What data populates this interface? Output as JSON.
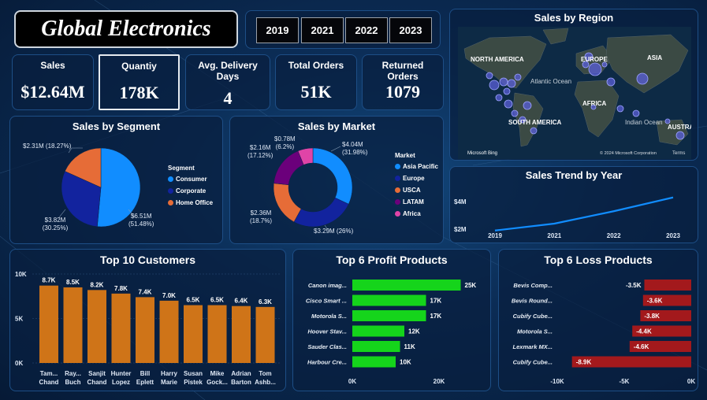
{
  "title": "Global Electronics",
  "years": [
    "2019",
    "2021",
    "2022",
    "2023"
  ],
  "kpis": {
    "sales": {
      "label": "Sales",
      "value": "$12.64M"
    },
    "quantity": {
      "label": "Quantiy",
      "value": "178K"
    },
    "delivery": {
      "label": "Avg. Delivery Days",
      "value": "4"
    },
    "orders": {
      "label": "Total Orders",
      "value": "51K"
    },
    "returned": {
      "label": "Returned Orders",
      "value": "1079"
    }
  },
  "map": {
    "title": "Sales by Region",
    "labels": [
      "NORTH AMERICA",
      "EUROPE",
      "ASIA",
      "Atlantic Ocean",
      "AFRICA",
      "SOUTH AMERICA",
      "Indian Ocean",
      "AUSTRA"
    ],
    "copyright": "© 2024 Microsoft Corporation",
    "terms": "Terms",
    "brand": "Microsoft Bing"
  },
  "segment": {
    "title": "Sales by Segment",
    "legend_title": "Segment",
    "items": [
      {
        "name": "Consumer",
        "label": "$6.51M (51.48%)",
        "pct": 51.48,
        "color": "#118dff"
      },
      {
        "name": "Corporate",
        "label": "$3.82M (30.25%)",
        "pct": 30.25,
        "color": "#12239e"
      },
      {
        "name": "Home Office",
        "label": "$2.31M (18.27%)",
        "pct": 18.27,
        "color": "#e66c37"
      }
    ]
  },
  "market": {
    "title": "Sales by Market",
    "legend_title": "Market",
    "items": [
      {
        "name": "Asia Pacific",
        "label": "$4.04M (31.98%)",
        "pct": 31.98,
        "color": "#118dff"
      },
      {
        "name": "Europe",
        "label": "$3.29M (26%)",
        "pct": 26,
        "color": "#12239e"
      },
      {
        "name": "USCA",
        "label": "$2.36M (18.7%)",
        "pct": 18.7,
        "color": "#e66c37"
      },
      {
        "name": "LATAM",
        "label": "$2.16M (17.12%)",
        "pct": 17.12,
        "color": "#6b007b"
      },
      {
        "name": "Africa",
        "label": "$0.78M (6.2%)",
        "pct": 6.2,
        "color": "#e044a7"
      }
    ]
  },
  "trend": {
    "title": "Sales Trend by Year",
    "y_ticks": [
      "$4M",
      "$2M"
    ],
    "x": [
      "2019",
      "2021",
      "2022",
      "2023"
    ],
    "values": [
      1.9,
      2.4,
      3.3,
      4.3
    ]
  },
  "customers": {
    "title": "Top 10 Customers",
    "y_ticks": [
      "10K",
      "5K",
      "0K"
    ],
    "items": [
      {
        "name": [
          "Tam...",
          "Chand"
        ],
        "value": 8.7,
        "label": "8.7K"
      },
      {
        "name": [
          "Ray...",
          "Buch"
        ],
        "value": 8.5,
        "label": "8.5K"
      },
      {
        "name": [
          "Sanjit",
          "Chand"
        ],
        "value": 8.2,
        "label": "8.2K"
      },
      {
        "name": [
          "Hunter",
          "Lopez"
        ],
        "value": 7.8,
        "label": "7.8K"
      },
      {
        "name": [
          "Bill",
          "Eplett"
        ],
        "value": 7.4,
        "label": "7.4K"
      },
      {
        "name": [
          "Harry",
          "Marie"
        ],
        "value": 7.0,
        "label": "7.0K"
      },
      {
        "name": [
          "Susan",
          "Pistek"
        ],
        "value": 6.5,
        "label": "6.5K"
      },
      {
        "name": [
          "Mike",
          "Gock..."
        ],
        "value": 6.5,
        "label": "6.5K"
      },
      {
        "name": [
          "Adrian",
          "Barton"
        ],
        "value": 6.4,
        "label": "6.4K"
      },
      {
        "name": [
          "Tom",
          "Ashb..."
        ],
        "value": 6.3,
        "label": "6.3K"
      }
    ]
  },
  "profit": {
    "title": "Top 6 Profit Products",
    "x_ticks": [
      "0K",
      "20K"
    ],
    "items": [
      {
        "name": "Canon imag...",
        "value": 25,
        "label": "25K"
      },
      {
        "name": "Cisco Smart ...",
        "value": 17,
        "label": "17K"
      },
      {
        "name": "Motorola S...",
        "value": 17,
        "label": "17K"
      },
      {
        "name": "Hoover Stav...",
        "value": 12,
        "label": "12K"
      },
      {
        "name": "Sauder Clas...",
        "value": 11,
        "label": "11K"
      },
      {
        "name": "Harbour Cre...",
        "value": 10,
        "label": "10K"
      }
    ]
  },
  "loss": {
    "title": "Top 6 Loss Products",
    "x_ticks": [
      "-10K",
      "-5K",
      "0K"
    ],
    "items": [
      {
        "name": "Bevis Comp...",
        "value": -3.5,
        "label": "-3.5K"
      },
      {
        "name": "Bevis Round...",
        "value": -3.6,
        "label": "-3.6K"
      },
      {
        "name": "Cubify Cube...",
        "value": -3.8,
        "label": "-3.8K"
      },
      {
        "name": "Motorola S...",
        "value": -4.4,
        "label": "-4.4K"
      },
      {
        "name": "Lexmark MX...",
        "value": -4.6,
        "label": "-4.6K"
      },
      {
        "name": "Cubify Cube...",
        "value": -8.9,
        "label": "-8.9K"
      }
    ]
  },
  "chart_data": [
    {
      "type": "pie",
      "title": "Sales by Segment",
      "categories": [
        "Consumer",
        "Corporate",
        "Home Office"
      ],
      "values": [
        6.51,
        3.82,
        2.31
      ]
    },
    {
      "type": "pie",
      "title": "Sales by Market",
      "categories": [
        "Asia Pacific",
        "Europe",
        "USCA",
        "LATAM",
        "Africa"
      ],
      "values": [
        4.04,
        3.29,
        2.36,
        2.16,
        0.78
      ]
    },
    {
      "type": "line",
      "title": "Sales Trend by Year",
      "x": [
        "2019",
        "2021",
        "2022",
        "2023"
      ],
      "values": [
        1.9,
        2.4,
        3.3,
        4.3
      ]
    },
    {
      "type": "bar",
      "title": "Top 10 Customers",
      "categories": [
        "Tam... Chand",
        "Ray... Buch",
        "Sanjit Chand",
        "Hunter Lopez",
        "Bill Eplett",
        "Harry Marie",
        "Susan Pistek",
        "Mike Gock...",
        "Adrian Barton",
        "Tom Ashb..."
      ],
      "values": [
        8.7,
        8.5,
        8.2,
        7.8,
        7.4,
        7.0,
        6.5,
        6.5,
        6.4,
        6.3
      ],
      "ylim": [
        0,
        10
      ]
    },
    {
      "type": "bar",
      "title": "Top 6 Profit Products",
      "categories": [
        "Canon imag...",
        "Cisco Smart ...",
        "Motorola S...",
        "Hoover Stav...",
        "Sauder Clas...",
        "Harbour Cre..."
      ],
      "values": [
        25,
        17,
        17,
        12,
        11,
        10
      ]
    },
    {
      "type": "bar",
      "title": "Top 6 Loss Products",
      "categories": [
        "Bevis Comp...",
        "Bevis Round...",
        "Cubify Cube...",
        "Motorola S...",
        "Lexmark MX...",
        "Cubify Cube..."
      ],
      "values": [
        -3.5,
        -3.6,
        -3.8,
        -4.4,
        -4.6,
        -8.9
      ]
    }
  ],
  "colors": {
    "bar_orange": "#cf7418",
    "profit_green": "#15d41b",
    "loss_red": "#a3191c",
    "accent": "#118dff"
  }
}
